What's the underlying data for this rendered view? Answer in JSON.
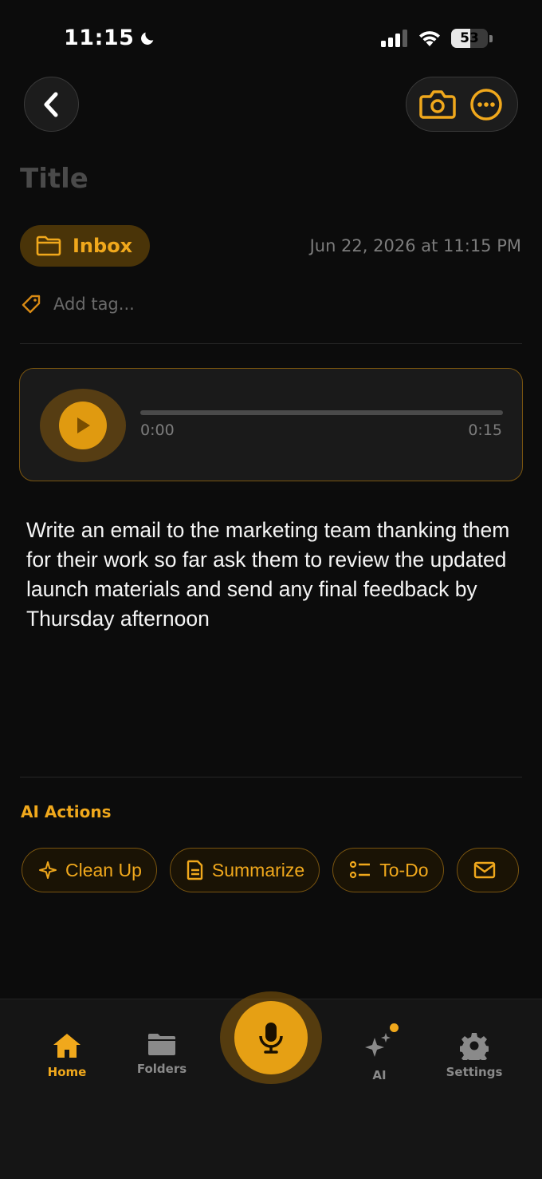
{
  "status_bar": {
    "time": "11:15",
    "battery": "53",
    "battery_level": 0.53
  },
  "note": {
    "title_placeholder": "Title",
    "folder": "Inbox",
    "date": "Jun 22, 2026 at 11:15 PM",
    "tag_placeholder": "Add tag...",
    "transcript": "Write an email to the marketing team thanking them for their work so far ask them to review the updated launch materials and send any final feedback by Thursday afternoon"
  },
  "player": {
    "current_time": "0:00",
    "total_time": "0:15",
    "progress": 0.0
  },
  "ai_actions": {
    "title": "AI Actions",
    "items": [
      {
        "label": "Clean Up",
        "icon": "sparkle-icon"
      },
      {
        "label": "Summarize",
        "icon": "document-icon"
      },
      {
        "label": "To-Do",
        "icon": "checklist-icon"
      },
      {
        "label": "",
        "icon": "email-icon"
      }
    ]
  },
  "tab_bar": {
    "items": [
      {
        "label": "Home",
        "icon": "home-icon",
        "active": true
      },
      {
        "label": "Folders",
        "icon": "folder-icon"
      },
      {
        "label": "AI",
        "icon": "ai-sparkles-icon",
        "badge": true
      },
      {
        "label": "Settings",
        "icon": "gear-icon"
      }
    ],
    "record_icon": "microphone-icon"
  },
  "colors": {
    "accent": "#f0a81c",
    "background": "#0c0c0c",
    "surface": "#1a1a1a"
  }
}
